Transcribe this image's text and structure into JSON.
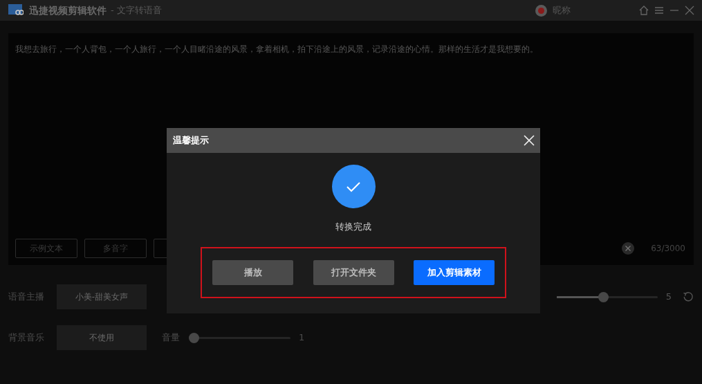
{
  "window": {
    "app_name": "迅捷视频剪辑软件",
    "subtitle": "- 文字转语音",
    "user": "昵称"
  },
  "editor": {
    "text": "我想去旅行，一个人背包，一个人旅行，一个人目睹沿途的风景，拿着相机，拍下沿途上的风景，记录沿途的心情。那样的生活才是我想要的。",
    "buttons": [
      "示例文本",
      "多音字"
    ],
    "count": "63/3000"
  },
  "settings": [
    {
      "label": "语音主播",
      "value": "小美-甜美女声"
    },
    {
      "label": "背景音乐",
      "value": "不使用",
      "slider_label": "音量",
      "slider": {
        "level": 0
      },
      "reading": "1"
    }
  ],
  "right_slider": {
    "level": 0.46,
    "reading": "5"
  },
  "dialog": {
    "title": "温馨提示",
    "message": "转换完成",
    "buttons": [
      {
        "label": "播放",
        "primary": false
      },
      {
        "label": "打开文件夹",
        "primary": false
      },
      {
        "label": "加入剪辑素材",
        "primary": true
      }
    ]
  }
}
